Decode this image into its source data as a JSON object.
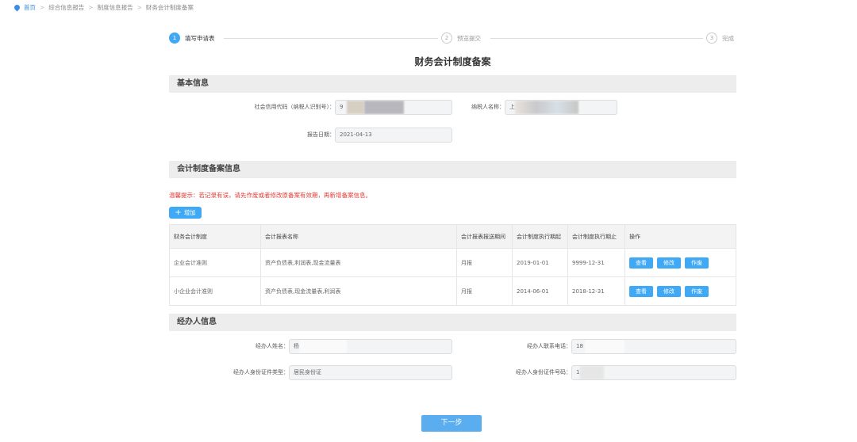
{
  "breadcrumb": [
    "首页",
    "综合信息报告",
    "制度信息报告",
    "财务会计制度备案"
  ],
  "steps": [
    {
      "num": "1",
      "label": "填写申请表"
    },
    {
      "num": "2",
      "label": "预览提交"
    },
    {
      "num": "3",
      "label": "完成"
    }
  ],
  "title": "财务会计制度备案",
  "basic": {
    "header": "基本信息",
    "credit_label": "社会信用代码（纳税人识别号）：",
    "credit_value": "9",
    "name_label": "纳税人名称：",
    "name_value": "上",
    "date_label": "报告日期：",
    "date_value": "2021-04-13"
  },
  "filing": {
    "header": "会计制度备案信息",
    "warning": "温馨提示：若记录有误，请先作废或者修改原备案有效期，再新增备案信息。",
    "add_label": "增加",
    "columns": [
      "财务会计制度",
      "会计报表名称",
      "会计报表报送期间",
      "会计制度执行期起",
      "会计制度执行期止",
      "操作"
    ],
    "rows": [
      [
        "企业会计准则",
        "资产负债表,利润表,现金流量表",
        "月报",
        "2019-01-01",
        "9999-12-31"
      ],
      [
        "小企业会计准则",
        "资产负债表,现金流量表,利润表",
        "月报",
        "2014-06-01",
        "2018-12-31"
      ]
    ],
    "actions": [
      "查看",
      "修改",
      "作废"
    ]
  },
  "agent": {
    "header": "经办人信息",
    "name_label": "经办人姓名：",
    "name_value": "杨",
    "phone_label": "经办人联系电话：",
    "phone_value": "18",
    "idtype_label": "经办人身份证件类型：",
    "idtype_value": "居民身份证",
    "idno_label": "经办人身份证件号码：",
    "idno_value": "1"
  },
  "next_label": "下一步"
}
